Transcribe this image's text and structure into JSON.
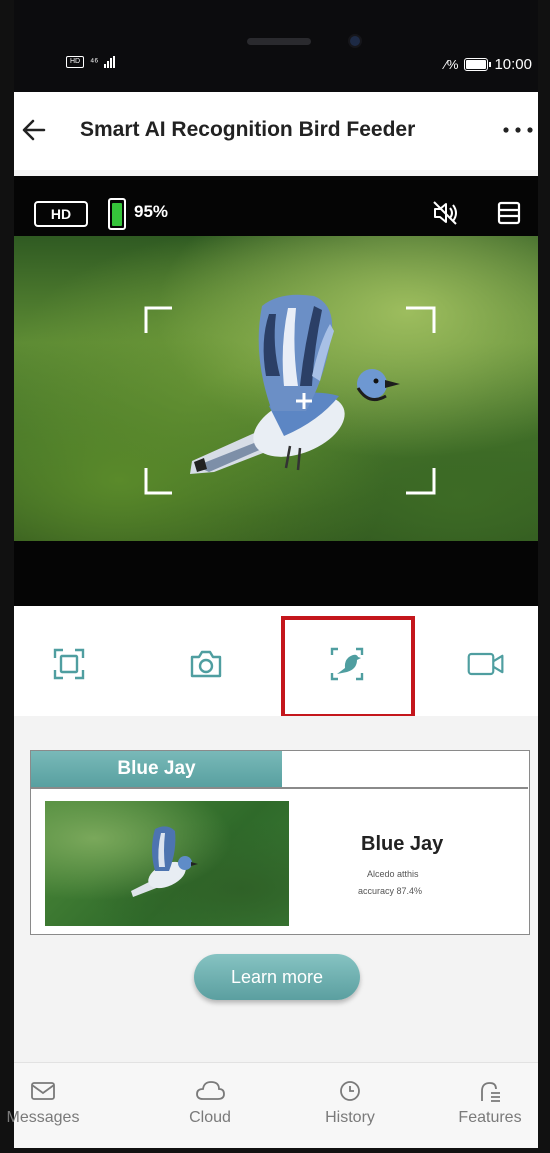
{
  "status_bar": {
    "sim_label": "HD",
    "signal_label": "⁴⁶",
    "extra_label": "⁄%",
    "time": "10:00"
  },
  "header": {
    "title": "Smart AI Recognition Bird Feeder"
  },
  "live": {
    "quality_badge": "HD",
    "battery_percent": "95%",
    "battery_level": 0.95,
    "battery_color": "#35c43a"
  },
  "controls": {
    "items": [
      "screenshot-frame-icon",
      "camera-icon",
      "bird-recognition-icon",
      "video-record-icon"
    ],
    "highlight_color": "#c4161c"
  },
  "result": {
    "tab_label": "Blue Jay",
    "species": "Blue Jay",
    "latin": "Alcedo atthis",
    "accuracy": "accuracy 87.4%",
    "button": "Learn more",
    "accent": "#5b9fa0"
  },
  "nav": {
    "items": [
      {
        "label": "Messages",
        "icon": "mail-icon"
      },
      {
        "label": "Cloud",
        "icon": "cloud-icon"
      },
      {
        "label": "History",
        "icon": "clock-icon"
      },
      {
        "label": "Features",
        "icon": "features-icon"
      }
    ]
  }
}
